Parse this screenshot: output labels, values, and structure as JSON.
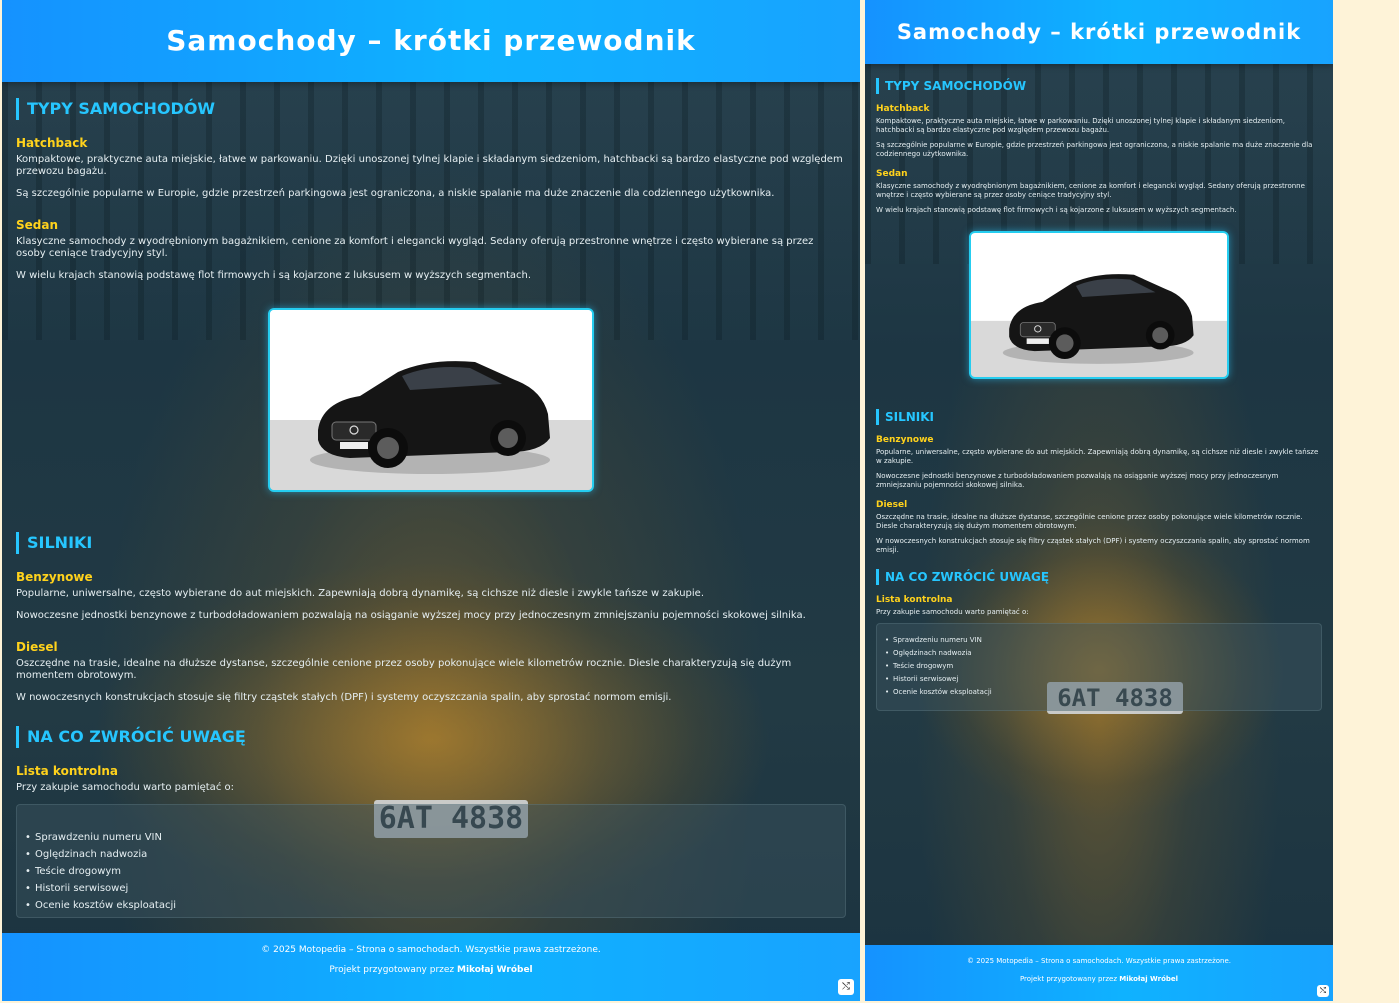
{
  "page": {
    "title": "Samochody – krótki przewodnik",
    "sections": {
      "types": {
        "title": "Typy samochodów",
        "hatchback": {
          "heading": "Hatchback",
          "p1": "Kompaktowe, praktyczne auta miejskie, łatwe w parkowaniu. Dzięki unoszonej tylnej klapie i składanym siedzeniom, hatchbacki są bardzo elastyczne pod względem przewozu bagażu.",
          "p2": "Są szczególnie popularne w Europie, gdzie przestrzeń parkingowa jest ograniczona, a niskie spalanie ma duże znaczenie dla codziennego użytkownika."
        },
        "sedan": {
          "heading": "Sedan",
          "p1": "Klasyczne samochody z wyodrębnionym bagażnikiem, cenione za komfort i elegancki wygląd. Sedany oferują przestronne wnętrze i często wybierane są przez osoby ceniące tradycyjny styl.",
          "p2": "W wielu krajach stanowią podstawę flot firmowych i są kojarzone z luksusem w wyższych segmentach."
        }
      },
      "engines": {
        "title": "Silniki",
        "petrol": {
          "heading": "Benzynowe",
          "p1": "Popularne, uniwersalne, często wybierane do aut miejskich. Zapewniają dobrą dynamikę, są cichsze niż diesle i zwykle tańsze w zakupie.",
          "p2": "Nowoczesne jednostki benzynowe z turbodoładowaniem pozwalają na osiąganie wyższej mocy przy jednoczesnym zmniejszaniu pojemności skokowej silnika."
        },
        "diesel": {
          "heading": "Diesel",
          "p1": "Oszczędne na trasie, idealne na dłuższe dystanse, szczególnie cenione przez osoby pokonujące wiele kilometrów rocznie. Diesle charakteryzują się dużym momentem obrotowym.",
          "p2": "W nowoczesnych konstrukcjach stosuje się filtry cząstek stałych (DPF) i systemy oczyszczania spalin, aby sprostać normom emisji."
        }
      },
      "attention": {
        "title": "Na co zwrócić uwagę",
        "heading": "Lista kontrolna",
        "intro": "Przy zakupie samochodu warto pamiętać o:",
        "items": [
          "Sprawdzeniu numeru VIN",
          "Oględzinach nadwozia",
          "Teście drogowym",
          "Historii serwisowej",
          "Ocenie kosztów eksploatacji"
        ]
      }
    },
    "background_plate": "6AT 4838",
    "footer": {
      "line1": "© 2025 Motopedia – Strona o samochodach. Wszystkie prawa zastrzeżone.",
      "line2_prefix": "Projekt przygotowany przez ",
      "author": "Mikołaj Wróbel"
    },
    "corner_icon": "shuffle-icon",
    "colors": {
      "header": "#0fb2ff",
      "accent_title": "#26c6ff",
      "subheading": "#ffd21c",
      "page_background": "#fef3d8"
    }
  }
}
